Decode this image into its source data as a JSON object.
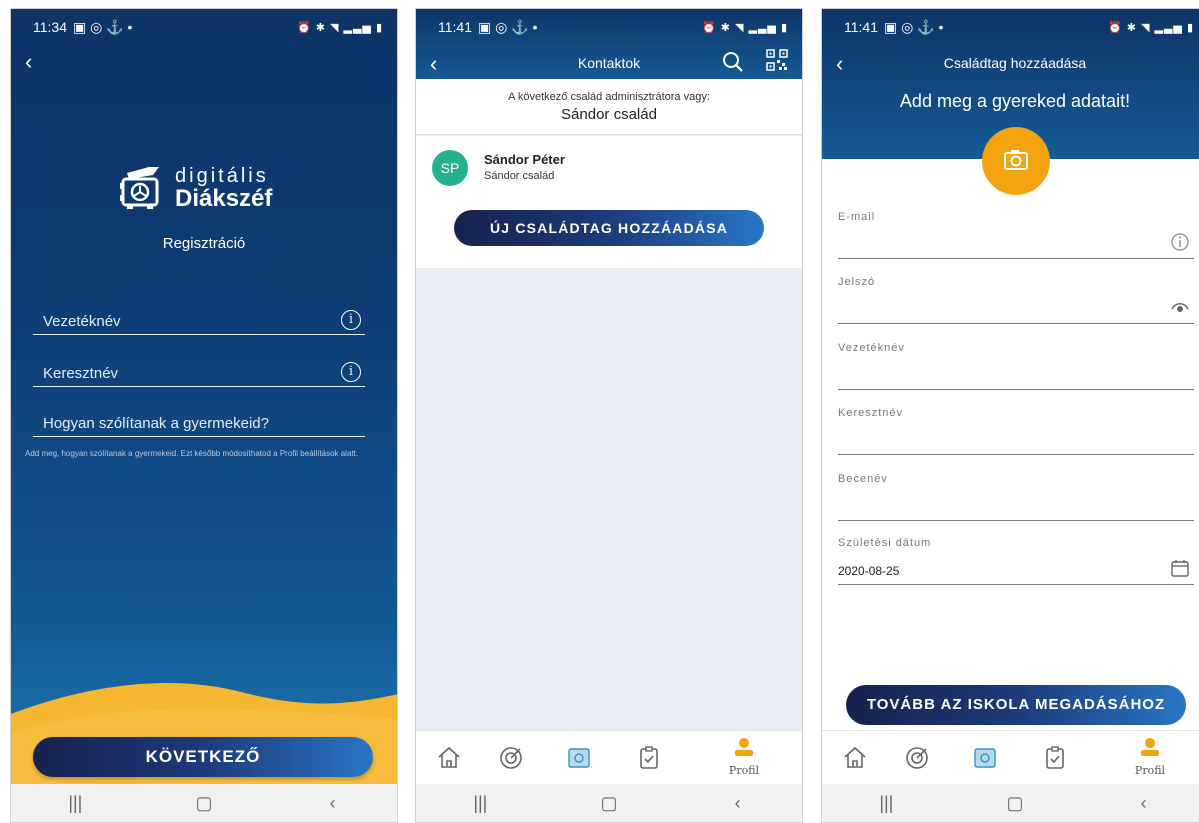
{
  "panel1": {
    "status_time": "11:34",
    "logo_line1": "digitális",
    "logo_line2": "Diákszéf",
    "title": "Regisztráció",
    "fields": [
      "Vezetéknév",
      "Keresztnév",
      "Hogyan szólítanak a gyermekeid?"
    ],
    "hint": "Add meg, hogyan szólítanak a gyermekeid. Ezt később módosíthatod a Profil beállítások alatt.",
    "next_button": "KÖVETKEZŐ"
  },
  "panel2": {
    "status_time": "11:41",
    "title": "Kontaktok",
    "admin_line": "A következő család adminisztrátora vagy:",
    "family_name": "Sándor család",
    "contact": {
      "initials": "SP",
      "name": "Sándor Péter",
      "family": "Sándor család"
    },
    "add_button": "ÚJ CSALÁDTAG HOZZÁADÁSA",
    "profile_tab": "Profil"
  },
  "panel3": {
    "status_time": "11:41",
    "title": "Családtag hozzáadása",
    "subtitle": "Add meg a gyereked adatait!",
    "fields": [
      {
        "label": "E-mail",
        "value": ""
      },
      {
        "label": "Jelszó",
        "value": ""
      },
      {
        "label": "Vezetéknév",
        "value": ""
      },
      {
        "label": "Keresztnév",
        "value": ""
      },
      {
        "label": "Becenév",
        "value": ""
      },
      {
        "label": "Születési dátum",
        "value": "2020-08-25"
      }
    ],
    "continue_button": "TOVÁBB AZ ISKOLA MEGADÁSÁHOZ",
    "profile_tab": "Profil"
  },
  "colors": {
    "header_dark": "#0e3467",
    "accent_orange": "#f2a30f",
    "avatar_green": "#27b08e",
    "wave_yellow": "#f5b731"
  }
}
